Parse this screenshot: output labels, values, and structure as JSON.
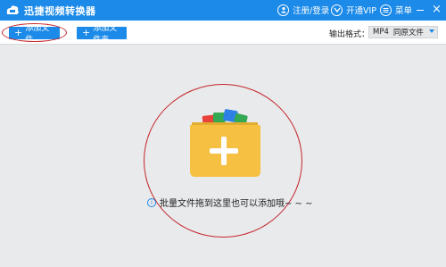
{
  "titlebar": {
    "title": "迅捷视频转换器",
    "login_label": "注册/登录",
    "vip_label": "开通VIP",
    "menu_label": "菜单",
    "close_glyph": "×"
  },
  "toolbar": {
    "add_file_label": "添加文件",
    "add_folder_label": "添加文件夹",
    "output_format_label": "输出格式：",
    "output_format_value": "MP4",
    "output_format_quality": "同原文件"
  },
  "main": {
    "drop_hint": "批量文件拖到这里也可以添加哦~ ~ ~"
  },
  "colors": {
    "accent": "#1b8ae8",
    "annotation": "#c4262a",
    "folder": "#f6c042"
  },
  "icons": [
    "app-logo-icon",
    "user-icon",
    "vip-icon",
    "menu-icon",
    "minimize-icon",
    "close-icon",
    "plus-icon",
    "folder-add-icon",
    "info-icon",
    "chevron-down-icon"
  ]
}
